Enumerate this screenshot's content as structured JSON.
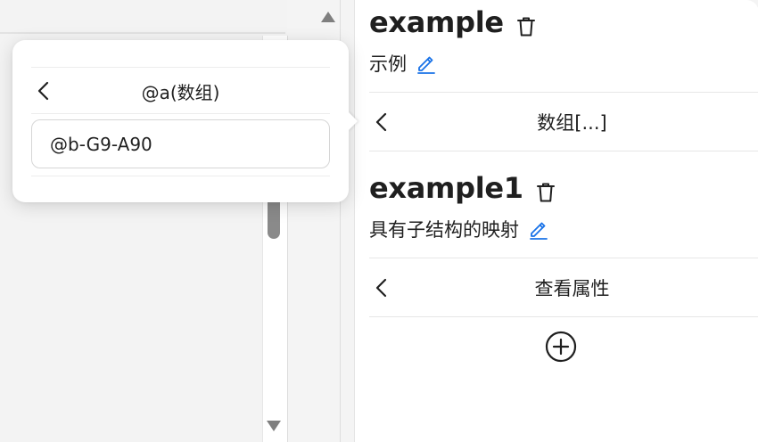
{
  "popover": {
    "title": "@a(数组)",
    "input_value": "@b-G9-A90"
  },
  "panel": {
    "entry1": {
      "title": "example",
      "subtitle": "示例",
      "nav_label": "数组[...]"
    },
    "entry2": {
      "title": "example1",
      "subtitle": "具有子结构的映射",
      "nav_label": "查看属性"
    }
  },
  "icons": {
    "back": "chevron-left-icon",
    "delete": "trash-icon",
    "edit": "pencil-icon",
    "add": "plus-circle-icon",
    "scroll_up": "triangle-up-icon",
    "scroll_down": "triangle-down-icon"
  },
  "colors": {
    "edit_accent": "#1a73e8",
    "text": "#1f1f1f",
    "divider": "#e6e6e6"
  }
}
